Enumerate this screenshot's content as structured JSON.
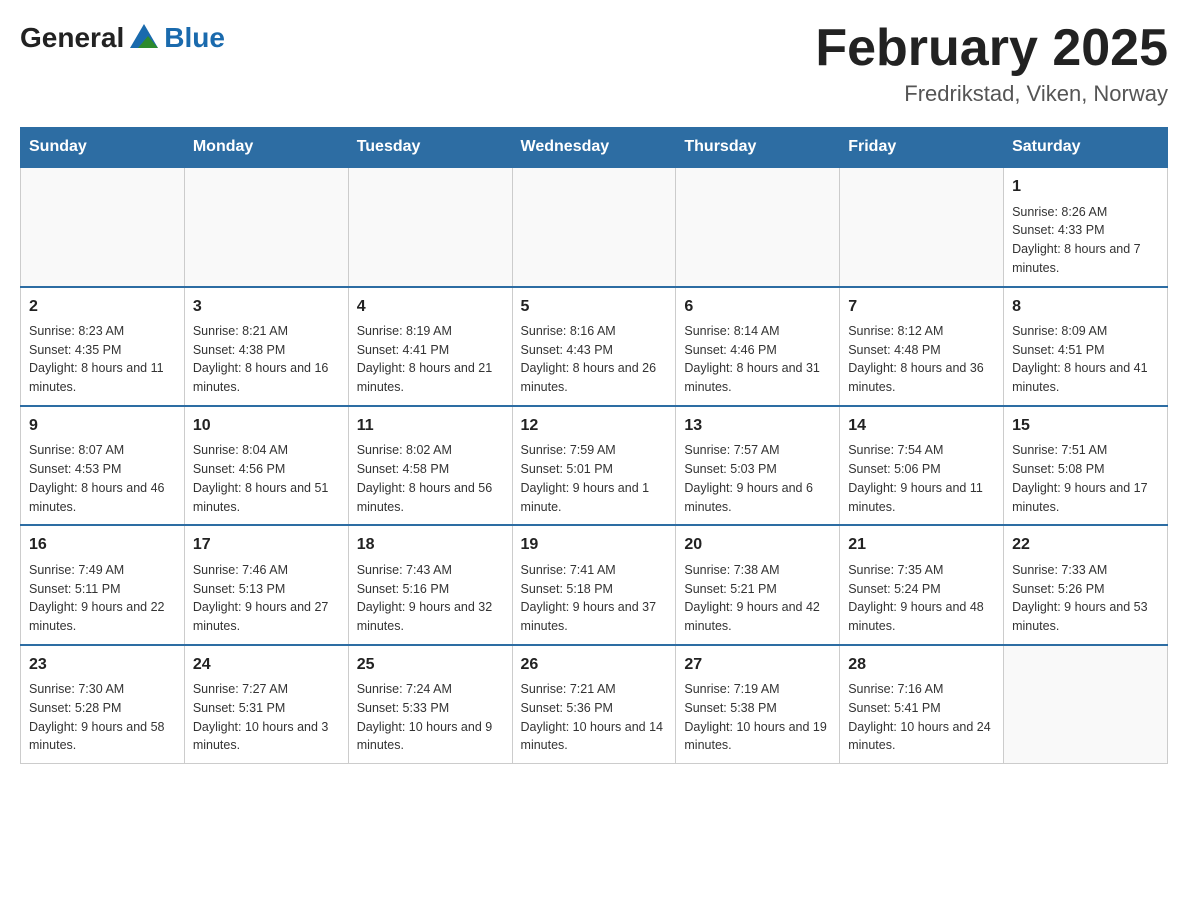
{
  "header": {
    "logo": {
      "text_general": "General",
      "text_blue": "Blue"
    },
    "title": "February 2025",
    "location": "Fredrikstad, Viken, Norway"
  },
  "days_of_week": [
    "Sunday",
    "Monday",
    "Tuesday",
    "Wednesday",
    "Thursday",
    "Friday",
    "Saturday"
  ],
  "weeks": [
    [
      {
        "day": "",
        "info": ""
      },
      {
        "day": "",
        "info": ""
      },
      {
        "day": "",
        "info": ""
      },
      {
        "day": "",
        "info": ""
      },
      {
        "day": "",
        "info": ""
      },
      {
        "day": "",
        "info": ""
      },
      {
        "day": "1",
        "info": "Sunrise: 8:26 AM\nSunset: 4:33 PM\nDaylight: 8 hours and 7 minutes."
      }
    ],
    [
      {
        "day": "2",
        "info": "Sunrise: 8:23 AM\nSunset: 4:35 PM\nDaylight: 8 hours and 11 minutes."
      },
      {
        "day": "3",
        "info": "Sunrise: 8:21 AM\nSunset: 4:38 PM\nDaylight: 8 hours and 16 minutes."
      },
      {
        "day": "4",
        "info": "Sunrise: 8:19 AM\nSunset: 4:41 PM\nDaylight: 8 hours and 21 minutes."
      },
      {
        "day": "5",
        "info": "Sunrise: 8:16 AM\nSunset: 4:43 PM\nDaylight: 8 hours and 26 minutes."
      },
      {
        "day": "6",
        "info": "Sunrise: 8:14 AM\nSunset: 4:46 PM\nDaylight: 8 hours and 31 minutes."
      },
      {
        "day": "7",
        "info": "Sunrise: 8:12 AM\nSunset: 4:48 PM\nDaylight: 8 hours and 36 minutes."
      },
      {
        "day": "8",
        "info": "Sunrise: 8:09 AM\nSunset: 4:51 PM\nDaylight: 8 hours and 41 minutes."
      }
    ],
    [
      {
        "day": "9",
        "info": "Sunrise: 8:07 AM\nSunset: 4:53 PM\nDaylight: 8 hours and 46 minutes."
      },
      {
        "day": "10",
        "info": "Sunrise: 8:04 AM\nSunset: 4:56 PM\nDaylight: 8 hours and 51 minutes."
      },
      {
        "day": "11",
        "info": "Sunrise: 8:02 AM\nSunset: 4:58 PM\nDaylight: 8 hours and 56 minutes."
      },
      {
        "day": "12",
        "info": "Sunrise: 7:59 AM\nSunset: 5:01 PM\nDaylight: 9 hours and 1 minute."
      },
      {
        "day": "13",
        "info": "Sunrise: 7:57 AM\nSunset: 5:03 PM\nDaylight: 9 hours and 6 minutes."
      },
      {
        "day": "14",
        "info": "Sunrise: 7:54 AM\nSunset: 5:06 PM\nDaylight: 9 hours and 11 minutes."
      },
      {
        "day": "15",
        "info": "Sunrise: 7:51 AM\nSunset: 5:08 PM\nDaylight: 9 hours and 17 minutes."
      }
    ],
    [
      {
        "day": "16",
        "info": "Sunrise: 7:49 AM\nSunset: 5:11 PM\nDaylight: 9 hours and 22 minutes."
      },
      {
        "day": "17",
        "info": "Sunrise: 7:46 AM\nSunset: 5:13 PM\nDaylight: 9 hours and 27 minutes."
      },
      {
        "day": "18",
        "info": "Sunrise: 7:43 AM\nSunset: 5:16 PM\nDaylight: 9 hours and 32 minutes."
      },
      {
        "day": "19",
        "info": "Sunrise: 7:41 AM\nSunset: 5:18 PM\nDaylight: 9 hours and 37 minutes."
      },
      {
        "day": "20",
        "info": "Sunrise: 7:38 AM\nSunset: 5:21 PM\nDaylight: 9 hours and 42 minutes."
      },
      {
        "day": "21",
        "info": "Sunrise: 7:35 AM\nSunset: 5:24 PM\nDaylight: 9 hours and 48 minutes."
      },
      {
        "day": "22",
        "info": "Sunrise: 7:33 AM\nSunset: 5:26 PM\nDaylight: 9 hours and 53 minutes."
      }
    ],
    [
      {
        "day": "23",
        "info": "Sunrise: 7:30 AM\nSunset: 5:28 PM\nDaylight: 9 hours and 58 minutes."
      },
      {
        "day": "24",
        "info": "Sunrise: 7:27 AM\nSunset: 5:31 PM\nDaylight: 10 hours and 3 minutes."
      },
      {
        "day": "25",
        "info": "Sunrise: 7:24 AM\nSunset: 5:33 PM\nDaylight: 10 hours and 9 minutes."
      },
      {
        "day": "26",
        "info": "Sunrise: 7:21 AM\nSunset: 5:36 PM\nDaylight: 10 hours and 14 minutes."
      },
      {
        "day": "27",
        "info": "Sunrise: 7:19 AM\nSunset: 5:38 PM\nDaylight: 10 hours and 19 minutes."
      },
      {
        "day": "28",
        "info": "Sunrise: 7:16 AM\nSunset: 5:41 PM\nDaylight: 10 hours and 24 minutes."
      },
      {
        "day": "",
        "info": ""
      }
    ]
  ]
}
